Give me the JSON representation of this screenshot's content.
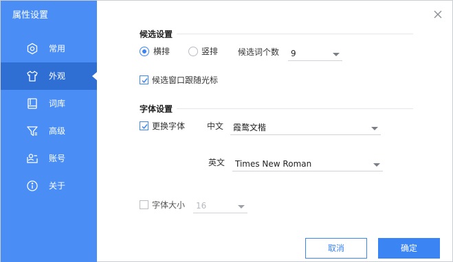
{
  "window": {
    "title": "属性设置"
  },
  "sidebar": {
    "items": [
      {
        "label": "常用",
        "icon": "gear-icon",
        "active": false
      },
      {
        "label": "外观",
        "icon": "shirt-icon",
        "active": true
      },
      {
        "label": "词库",
        "icon": "book-icon",
        "active": false
      },
      {
        "label": "高级",
        "icon": "filter-icon",
        "active": false
      },
      {
        "label": "账号",
        "icon": "account-card-icon",
        "active": false
      },
      {
        "label": "关于",
        "icon": "info-icon",
        "active": false
      }
    ]
  },
  "candidate": {
    "section_title": "候选设置",
    "orientation": {
      "horizontal_label": "横排",
      "vertical_label": "竖排",
      "selected": "horizontal"
    },
    "count_label": "候选词个数",
    "count_value": "9",
    "follow_cursor_label": "候选窗口跟随光标",
    "follow_cursor_checked": true
  },
  "font": {
    "section_title": "字体设置",
    "change_font_label": "更换字体",
    "change_font_checked": true,
    "chinese_label": "中文",
    "chinese_value": "霞鹜文楷",
    "english_label": "英文",
    "english_value": "Times New Roman",
    "size_label": "字体大小",
    "size_checked": false,
    "size_value": "16"
  },
  "footer": {
    "cancel_label": "取消",
    "ok_label": "确定"
  },
  "colors": {
    "sidebar": "#4a8ef5",
    "sidebar_active": "#2f6fd3",
    "accent": "#3b84f3"
  }
}
